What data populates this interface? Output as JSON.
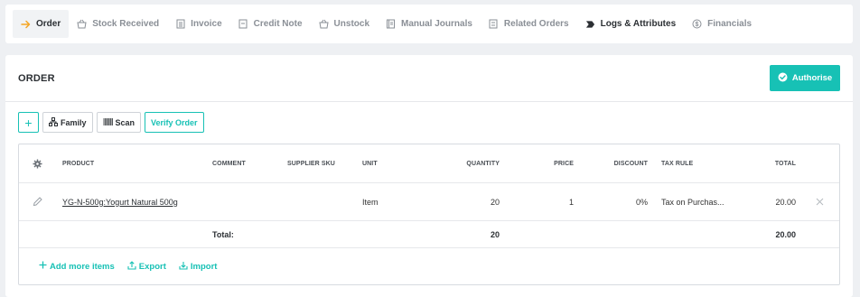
{
  "tabs": [
    {
      "label": "Order",
      "icon": "arrow-right-icon"
    },
    {
      "label": "Stock Received",
      "icon": "basket-icon"
    },
    {
      "label": "Invoice",
      "icon": "invoice-icon"
    },
    {
      "label": "Credit Note",
      "icon": "credit-note-icon"
    },
    {
      "label": "Unstock",
      "icon": "basket-icon"
    },
    {
      "label": "Manual Journals",
      "icon": "journal-icon"
    },
    {
      "label": "Related Orders",
      "icon": "document-icon"
    },
    {
      "label": "Logs & Attributes",
      "icon": "tag-icon"
    },
    {
      "label": "Financials",
      "icon": "dollar-icon"
    }
  ],
  "order": {
    "title": "ORDER",
    "authorise_label": "Authorise"
  },
  "toolbar": {
    "add_label": "+",
    "family_label": "Family",
    "scan_label": "Scan",
    "verify_label": "Verify Order"
  },
  "table": {
    "headers": {
      "product": "PRODUCT",
      "comment": "COMMENT",
      "supplier_sku": "SUPPLIER SKU",
      "unit": "UNIT",
      "quantity": "QUANTITY",
      "price": "PRICE",
      "discount": "DISCOUNT",
      "tax_rule": "TAX RULE",
      "total": "TOTAL"
    },
    "rows": [
      {
        "product": "YG-N-500g:Yogurt Natural 500g",
        "comment": "",
        "supplier_sku": "",
        "unit": "Item",
        "quantity": "20",
        "price": "1",
        "discount": "0%",
        "tax_rule": "Tax on Purchas...",
        "total": "20.00"
      }
    ],
    "totals": {
      "label": "Total:",
      "quantity": "20",
      "total": "20.00"
    }
  },
  "footer": {
    "add_more_label": "Add more items",
    "export_label": "Export",
    "import_label": "Import"
  },
  "colors": {
    "accent": "#17c1b5",
    "active_arrow": "#f5a623"
  }
}
